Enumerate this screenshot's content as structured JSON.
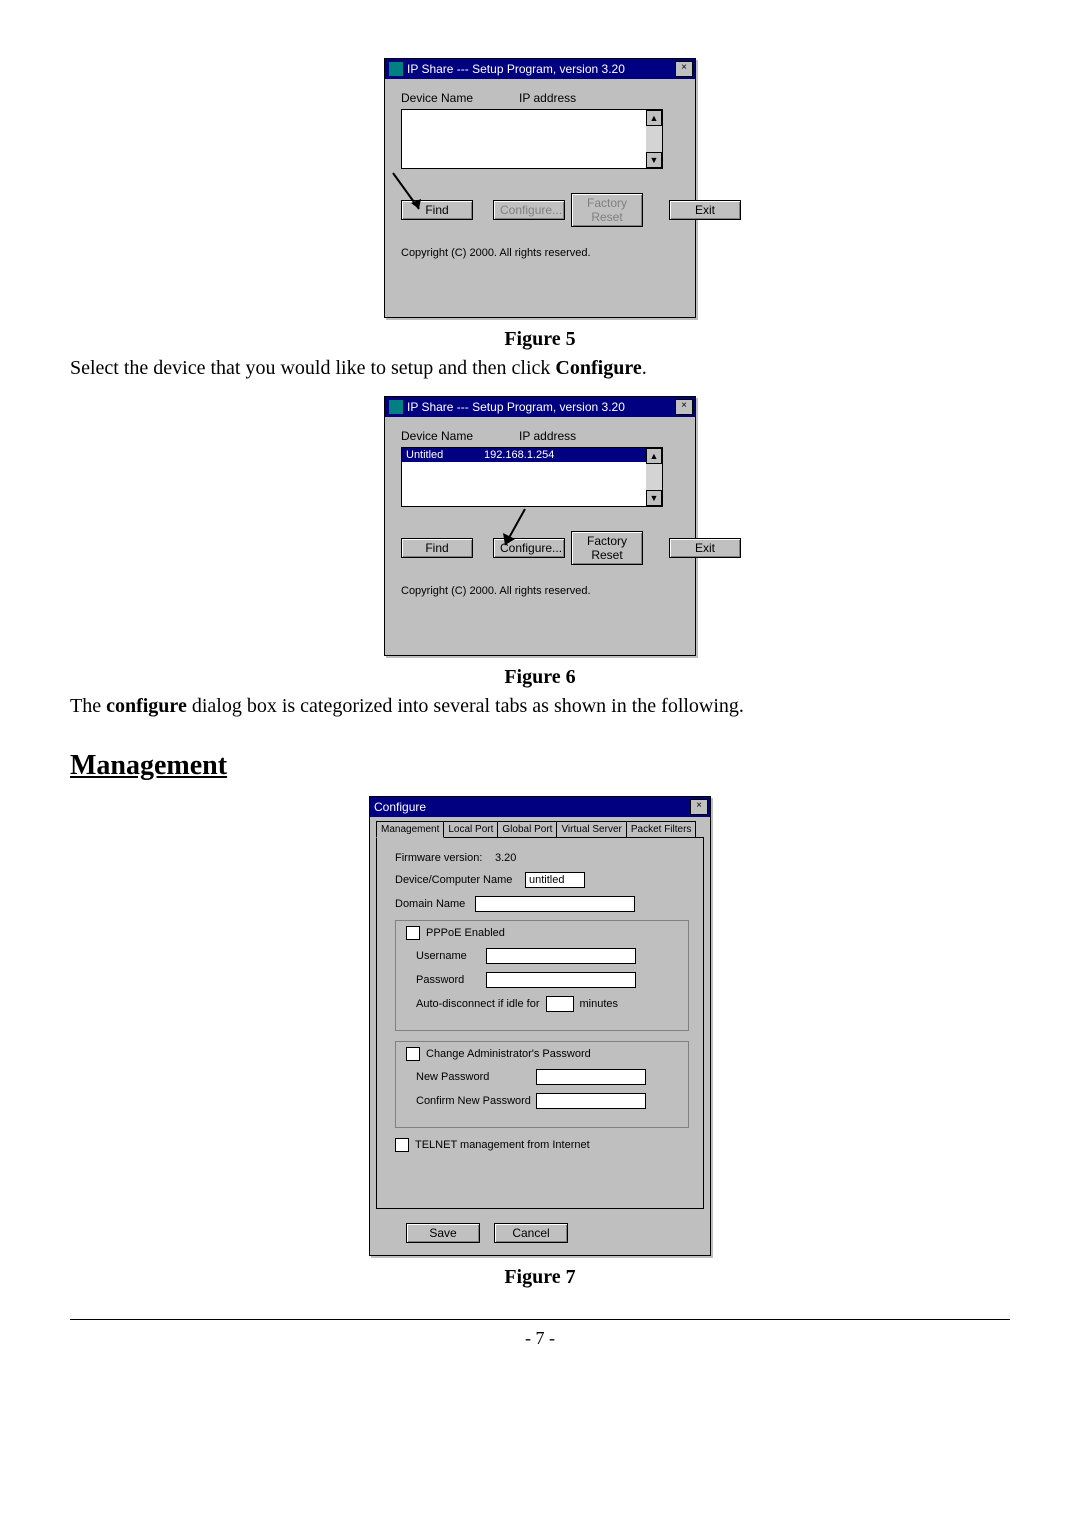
{
  "fig5": {
    "caption": "Figure 5",
    "window_title": "IP Share --- Setup Program, version 3.20",
    "col_device_name": "Device Name",
    "col_ip_address": "IP address",
    "btn_find": "Find",
    "btn_configure": "Configure...",
    "btn_factory_reset": "Factory Reset",
    "btn_exit": "Exit",
    "copyright": "Copyright (C) 2000.  All rights reserved."
  },
  "para1_pre": "Select the device that you would like to setup and then click ",
  "para1_bold": "Configure",
  "para1_post": ".",
  "fig6": {
    "caption": "Figure 6",
    "window_title": "IP Share --- Setup Program, version 3.20",
    "col_device_name": "Device Name",
    "col_ip_address": "IP address",
    "row_device_name": "Untitled",
    "row_ip": "192.168.1.254",
    "btn_find": "Find",
    "btn_configure": "Configure...",
    "btn_factory_reset": "Factory Reset",
    "btn_exit": "Exit",
    "copyright": "Copyright (C) 2000.  All rights reserved."
  },
  "para2_pre": "The ",
  "para2_bold": "configure",
  "para2_post": " dialog box is categorized into several tabs as shown in the following.",
  "section_heading": "Management",
  "fig7": {
    "caption": "Figure 7",
    "window_title": "Configure",
    "tabs": {
      "management": "Management",
      "local_port": "Local Port",
      "global_port": "Global Port",
      "virtual_server": "Virtual Server",
      "packet_filters": "Packet Filters"
    },
    "firmware_label": "Firmware version:",
    "firmware_value": "3.20",
    "device_name_label": "Device/Computer Name",
    "device_name_value": "untitled",
    "domain_name_label": "Domain Name",
    "domain_name_value": "",
    "pppoe_enabled": "PPPoE Enabled",
    "username_label": "Username",
    "username_value": "",
    "password_label": "Password",
    "password_value": "",
    "auto_disc_pre": "Auto-disconnect if idle for",
    "auto_disc_value": "",
    "auto_disc_post": "minutes",
    "change_admin_pw": "Change Administrator's Password",
    "new_pw_label": "New Password",
    "new_pw_value": "",
    "confirm_pw_label": "Confirm New Password",
    "confirm_pw_value": "",
    "telnet_label": "TELNET management from Internet",
    "btn_save": "Save",
    "btn_cancel": "Cancel"
  },
  "page_number": "- 7 -"
}
